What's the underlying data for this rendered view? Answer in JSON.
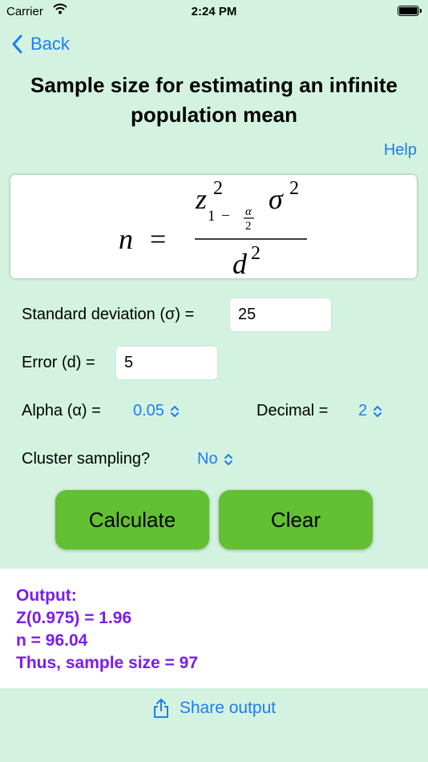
{
  "status_bar": {
    "carrier": "Carrier",
    "time": "2:24 PM"
  },
  "nav": {
    "back_label": "Back"
  },
  "title": "Sample size for estimating an infinite population mean",
  "help_label": "Help",
  "formula": {
    "n": "n",
    "equals": "=",
    "z": "z",
    "sigma": "σ",
    "d": "d",
    "exp": "2",
    "sub_one": "1",
    "sub_minus": "−",
    "alpha": "α",
    "two": "2"
  },
  "fields": {
    "std_dev_label": "Standard deviation (σ) =",
    "std_dev_value": "25",
    "error_label": "Error (d) =",
    "error_value": "5",
    "alpha_label": "Alpha (α) =",
    "alpha_value": "0.05",
    "decimal_label": "Decimal =",
    "decimal_value": "2",
    "cluster_label": "Cluster sampling?",
    "cluster_value": "No"
  },
  "buttons": {
    "calculate": "Calculate",
    "clear": "Clear"
  },
  "output": {
    "heading": "Output:",
    "z_line": "Z(0.975) = 1.96",
    "n_line": "n = 96.04",
    "result_line": "Thus, sample size =  97"
  },
  "share_label": "Share output",
  "colors": {
    "background": "#d3f3e0",
    "accent": "#1f7cf5",
    "button": "#62c032",
    "output_text": "#7a1cf0"
  }
}
